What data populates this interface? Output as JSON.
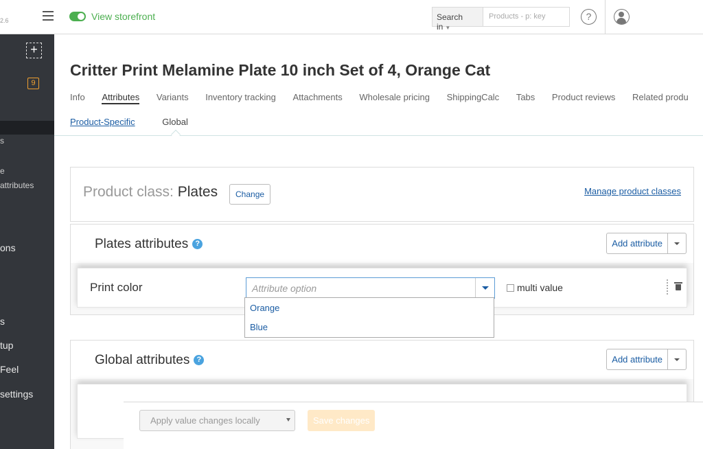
{
  "header": {
    "version": "2.6",
    "storefront_label": "View storefront",
    "search_in_label": "Search in",
    "search_placeholder": "Products - p: key"
  },
  "sidebar": {
    "badge_count": "9",
    "items": [
      {
        "label": "s"
      },
      {
        "label": "e"
      },
      {
        "label": "attributes"
      },
      {
        "label": "ons"
      },
      {
        "label": "s"
      },
      {
        "label": "tup"
      },
      {
        "label": "Feel"
      },
      {
        "label": "settings"
      }
    ]
  },
  "page": {
    "title": "Critter Print Melamine Plate 10 inch Set of 4, Orange Cat"
  },
  "tabs": [
    {
      "label": "Info"
    },
    {
      "label": "Attributes",
      "active": true
    },
    {
      "label": "Variants"
    },
    {
      "label": "Inventory tracking"
    },
    {
      "label": "Attachments"
    },
    {
      "label": "Wholesale pricing"
    },
    {
      "label": "ShippingCalc"
    },
    {
      "label": "Tabs"
    },
    {
      "label": "Product reviews"
    },
    {
      "label": "Related produ"
    }
  ],
  "subtabs": [
    {
      "label": "Product-Specific"
    },
    {
      "label": "Global"
    }
  ],
  "product_class": {
    "label": "Product class:",
    "value": "Plates",
    "change_label": "Change",
    "manage_label": "Manage product classes"
  },
  "plates_attributes": {
    "title": "Plates attributes",
    "add_label": "Add attribute",
    "row": {
      "name": "Print color",
      "placeholder": "Attribute option",
      "multi_label": "multi value"
    },
    "options": [
      "Orange",
      "Blue"
    ]
  },
  "global_attributes": {
    "title": "Global attributes",
    "add_label": "Add attribute"
  },
  "footer": {
    "apply_label": "Apply value changes locally",
    "save_label": "Save changes"
  },
  "colors": {
    "accent": "#1a5ca3",
    "storefront_green": "#4caf50",
    "sidebar_bg": "#33363b",
    "help_blue": "#4aa3df"
  }
}
